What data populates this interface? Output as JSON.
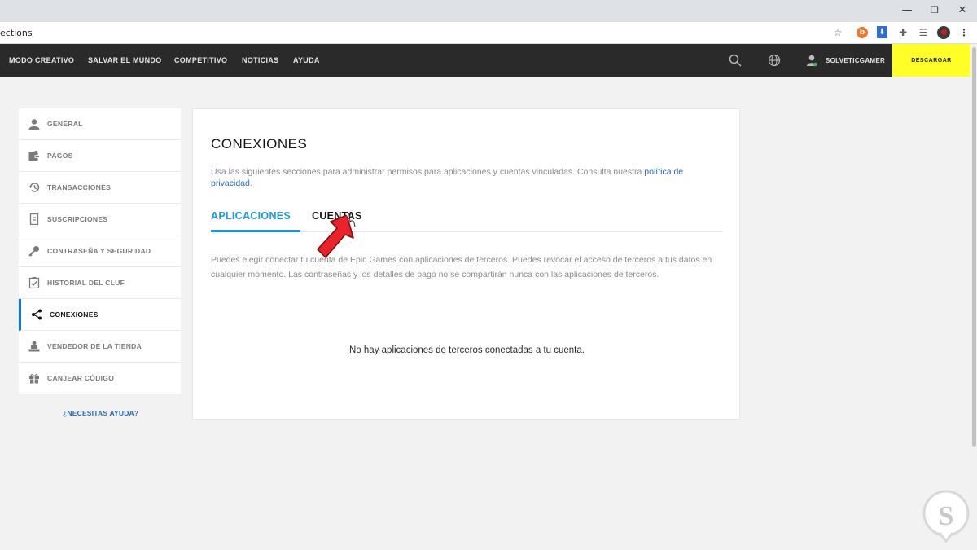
{
  "browser": {
    "url_fragment": "ections"
  },
  "nav": {
    "links": [
      "MODO CREATIVO",
      "SALVAR EL MUNDO",
      "COMPETITIVO",
      "NOTICIAS",
      "AYUDA"
    ],
    "username": "SOLVETICGAMER",
    "download_label": "DESCARGAR"
  },
  "sidebar": {
    "items": [
      {
        "label": "GENERAL",
        "icon": "user-icon"
      },
      {
        "label": "PAGOS",
        "icon": "wallet-icon"
      },
      {
        "label": "TRANSACCIONES",
        "icon": "history-icon"
      },
      {
        "label": "SUSCRIPCIONES",
        "icon": "receipt-icon"
      },
      {
        "label": "CONTRASEÑA Y SEGURIDAD",
        "icon": "key-icon"
      },
      {
        "label": "HISTORIAL DEL CLUF",
        "icon": "clipboard-check-icon"
      },
      {
        "label": "CONEXIONES",
        "icon": "share-icon"
      },
      {
        "label": "VENDEDOR DE LA TIENDA",
        "icon": "creator-icon"
      },
      {
        "label": "CANJEAR CÓDIGO",
        "icon": "gift-icon"
      }
    ],
    "active_index": 6,
    "help_label": "¿NECESITAS AYUDA?"
  },
  "main": {
    "title": "CONEXIONES",
    "description": "Usa las siguientes secciones para administrar permisos para aplicaciones y cuentas vinculadas. Consulta nuestra ",
    "policy_link": "política de privacidad",
    "description_end": ".",
    "tabs": [
      {
        "label": "APLICACIONES"
      },
      {
        "label": "CUENTAS"
      }
    ],
    "body": "Puedes elegir conectar tu cuenta de Epic Games con aplicaciones de terceros. Puedes revocar el acceso de terceros a tus datos en cualquier momento. Las contraseñas y los detalles de pago no se compartirán nunca con las aplicaciones de terceros.",
    "empty_message": "No hay aplicaciones de terceros conectadas a tu cuenta."
  },
  "colors": {
    "accent": "#1a9ae0",
    "link": "#2a6ab8",
    "download": "#ffff27",
    "nav_bg": "#2a2a2a",
    "annotation_arrow": "#e8232a"
  }
}
